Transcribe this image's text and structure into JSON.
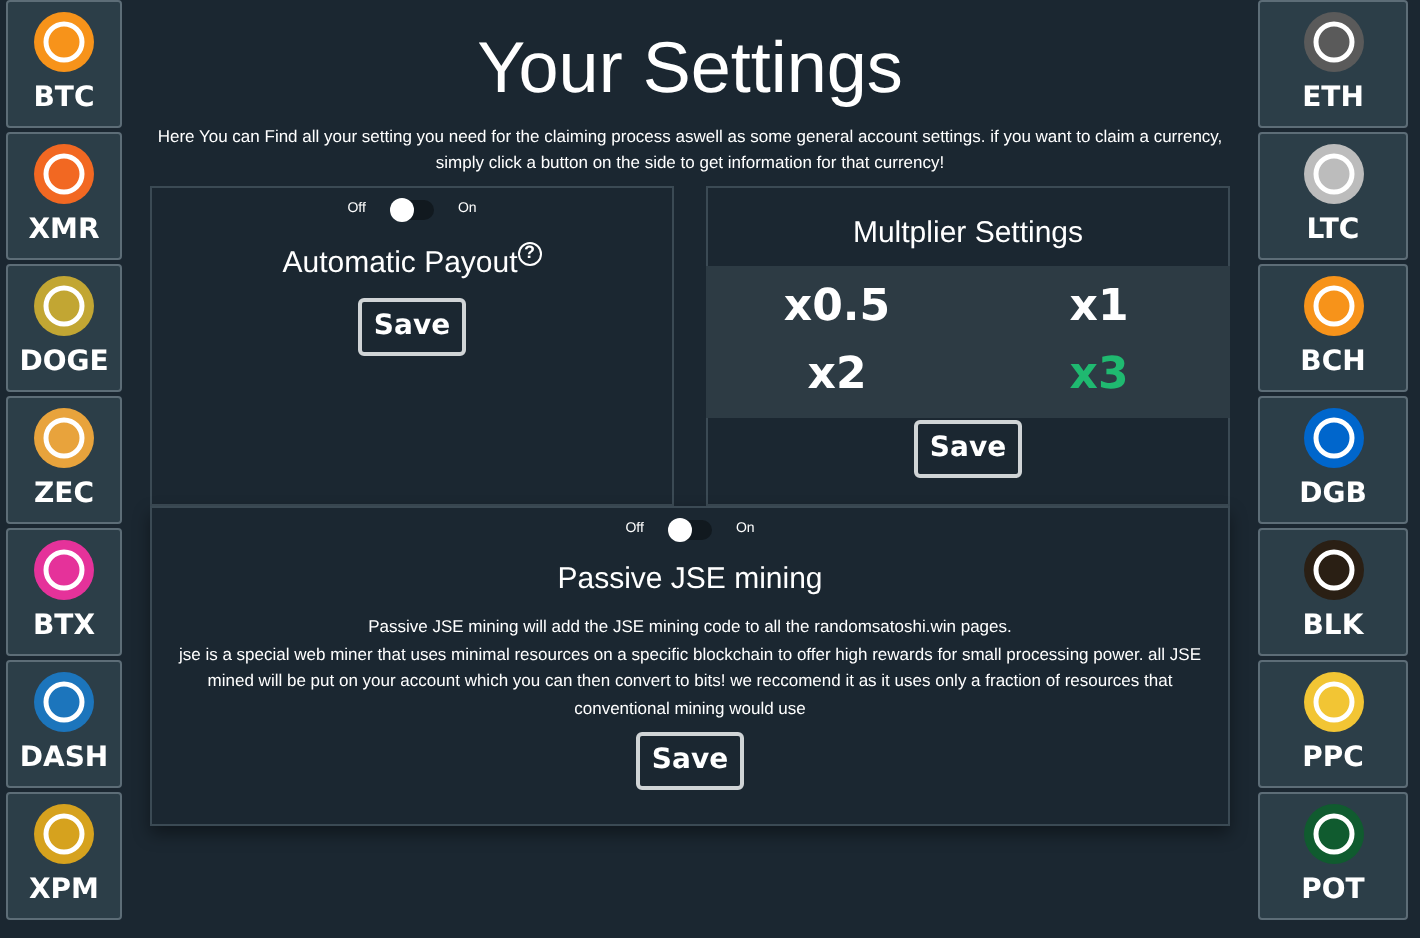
{
  "left_coins": [
    {
      "label": "BTC",
      "color": "#f7931a"
    },
    {
      "label": "XMR",
      "color": "#f26822"
    },
    {
      "label": "DOGE",
      "color": "#c2a633"
    },
    {
      "label": "ZEC",
      "color": "#e8a33c"
    },
    {
      "label": "BTX",
      "color": "#e5329a"
    },
    {
      "label": "DASH",
      "color": "#1c75bc"
    },
    {
      "label": "XPM",
      "color": "#d6a21e"
    }
  ],
  "right_coins": [
    {
      "label": "ETH",
      "color": "#5a5a5a"
    },
    {
      "label": "LTC",
      "color": "#bcbcbc"
    },
    {
      "label": "BCH",
      "color": "#f7931a"
    },
    {
      "label": "DGB",
      "color": "#0066cc"
    },
    {
      "label": "BLK",
      "color": "#2a1f14"
    },
    {
      "label": "PPC",
      "color": "#f2c534"
    },
    {
      "label": "POT",
      "color": "#105b2f"
    }
  ],
  "title": "Your Settings",
  "intro": "Here You can Find all your setting you need for the claiming process aswell as some general account settings. if you want to claim a currency, simply click a button on the side to get information for that currency!",
  "auto_payout": {
    "toggle": {
      "off_label": "Off",
      "on_label": "On",
      "on": false
    },
    "title": "Automatic Payout",
    "help": "?",
    "button": "Save"
  },
  "multiplier": {
    "title": "Multplier Settings",
    "options": [
      {
        "label": "x0.5",
        "selected": false
      },
      {
        "label": "x1",
        "selected": false
      },
      {
        "label": "x2",
        "selected": false
      },
      {
        "label": "x3",
        "selected": true
      }
    ],
    "button": "Save"
  },
  "jse": {
    "toggle": {
      "off_label": "Off",
      "on_label": "On",
      "on": false
    },
    "title": "Passive JSE mining",
    "lines": [
      "Passive JSE mining will add the JSE mining code to all the randomsatoshi.win pages.",
      "jse is a special web miner that uses minimal resources on a specific blockchain to offer high rewards for small processing power. all JSE mined will be put on your account which you can then convert to bits! we reccomend it as it uses only a fraction of resources that conventional mining would use"
    ],
    "button": "Save"
  }
}
